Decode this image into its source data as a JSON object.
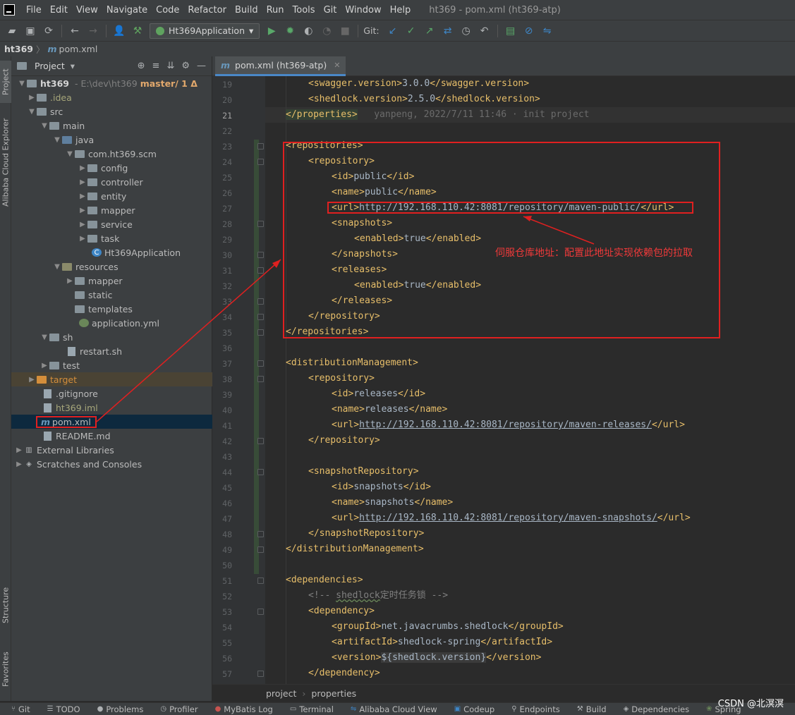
{
  "menu": [
    "File",
    "Edit",
    "View",
    "Navigate",
    "Code",
    "Refactor",
    "Build",
    "Run",
    "Tools",
    "Git",
    "Window",
    "Help"
  ],
  "window_title": "ht369 - pom.xml (ht369-atp)",
  "toolbar": {
    "run_config": "Ht369Application",
    "git_label": "Git:"
  },
  "breadcrumb": {
    "root": "ht369",
    "file": "pom.xml"
  },
  "left_strip": {
    "project": "Project",
    "alibaba": "Alibaba Cloud Explorer",
    "structure": "Structure",
    "favorites": "Favorites"
  },
  "project_panel": {
    "title": "Project"
  },
  "tree": {
    "root_name": "ht369",
    "root_path": "- E:\\dev\\ht369",
    "root_branch": "master/ 1 Δ",
    "idea": ".idea",
    "src": "src",
    "main": "main",
    "java": "java",
    "pkg": "com.ht369.scm",
    "config": "config",
    "controller": "controller",
    "entity": "entity",
    "mapper": "mapper",
    "service": "service",
    "task": "task",
    "app": "Ht369Application",
    "resources": "resources",
    "res_mapper": "mapper",
    "static": "static",
    "templates": "templates",
    "app_yml": "application.yml",
    "sh": "sh",
    "restart": "restart.sh",
    "test": "test",
    "target": "target",
    "gitignore": ".gitignore",
    "iml": "ht369.iml",
    "pom": "pom.xml",
    "readme": "README.md",
    "ext_libs": "External Libraries",
    "scratches": "Scratches and Consoles"
  },
  "editor_tab": "pom.xml (ht369-atp)",
  "line_numbers": [
    "19",
    "20",
    "21",
    "22",
    "23",
    "24",
    "25",
    "26",
    "27",
    "28",
    "29",
    "30",
    "31",
    "32",
    "33",
    "34",
    "35",
    "36",
    "37",
    "38",
    "39",
    "40",
    "41",
    "42",
    "43",
    "44",
    "45",
    "46",
    "47",
    "48",
    "49",
    "50",
    "51",
    "52",
    "53",
    "54",
    "55",
    "56",
    "57"
  ],
  "code": {
    "l19_open": "<swagger.version>",
    "l19_val": "3.0.0",
    "l19_close": "</swagger.version>",
    "l20_open": "<shedlock.version>",
    "l20_val": "2.5.0",
    "l20_close": "</shedlock.version>",
    "l21_tag": "</properties>",
    "l21_blame": "yanpeng, 2022/7/11 11:46 · init project",
    "l23": "<repositories>",
    "l24": "<repository>",
    "l25_open": "<id>",
    "l25_val": "public",
    "l25_close": "</id>",
    "l26_open": "<name>",
    "l26_val": "public",
    "l26_close": "</name>",
    "l27_open": "<url>",
    "l27_val": "http://192.168.110.42:8081/repository/maven-public/",
    "l27_close": "</url>",
    "l28": "<snapshots>",
    "l29_open": "<enabled>",
    "l29_val": "true",
    "l29_close": "</enabled>",
    "l30": "</snapshots>",
    "l31": "<releases>",
    "l32_open": "<enabled>",
    "l32_val": "true",
    "l32_close": "</enabled>",
    "l33": "</releases>",
    "l34": "</repository>",
    "l35": "</repositories>",
    "l37": "<distributionManagement>",
    "l38": "<repository>",
    "l39_open": "<id>",
    "l39_val": "releases",
    "l39_close": "</id>",
    "l40_open": "<name>",
    "l40_val": "releases",
    "l40_close": "</name>",
    "l41_open": "<url>",
    "l41_val": "http://192.168.110.42:8081/repository/maven-releases/",
    "l41_close": "</url>",
    "l42": "</repository>",
    "l44": "<snapshotRepository>",
    "l45_open": "<id>",
    "l45_val": "snapshots",
    "l45_close": "</id>",
    "l46_open": "<name>",
    "l46_val": "snapshots",
    "l46_close": "</name>",
    "l47_open": "<url>",
    "l47_val": "http://192.168.110.42:8081/repository/maven-snapshots/",
    "l47_close": "</url>",
    "l48": "</snapshotRepository>",
    "l49": "</distributionManagement>",
    "l51": "<dependencies>",
    "l52_a": "<!-- ",
    "l52_b": "shedlock",
    "l52_c": "定时任务锁 -->",
    "l53": "<dependency>",
    "l54_open": "<groupId>",
    "l54_val": "net.javacrumbs.shedlock",
    "l54_close": "</groupId>",
    "l55_open": "<artifactId>",
    "l55_val": "shedlock-spring",
    "l55_close": "</artifactId>",
    "l56_open": "<version>",
    "l56_val": "${shedlock.version}",
    "l56_close": "</version>",
    "l57": "</dependency>"
  },
  "annotation": "伺服仓库地址：配置此地址实现依赖包的拉取",
  "editor_breadcrumb": [
    "project",
    "properties"
  ],
  "status_bar": [
    "Git",
    "TODO",
    "Problems",
    "Profiler",
    "MyBatis Log",
    "Terminal",
    "Alibaba Cloud View",
    "Codeup",
    "Endpoints",
    "Build",
    "Dependencies",
    "Spring"
  ],
  "watermark": "CSDN @北溟溟",
  "colors": {
    "tag": "#e8bf6a",
    "text": "#a9b7c6",
    "annotation_red": "#e02020",
    "selection": "#0d293e"
  }
}
